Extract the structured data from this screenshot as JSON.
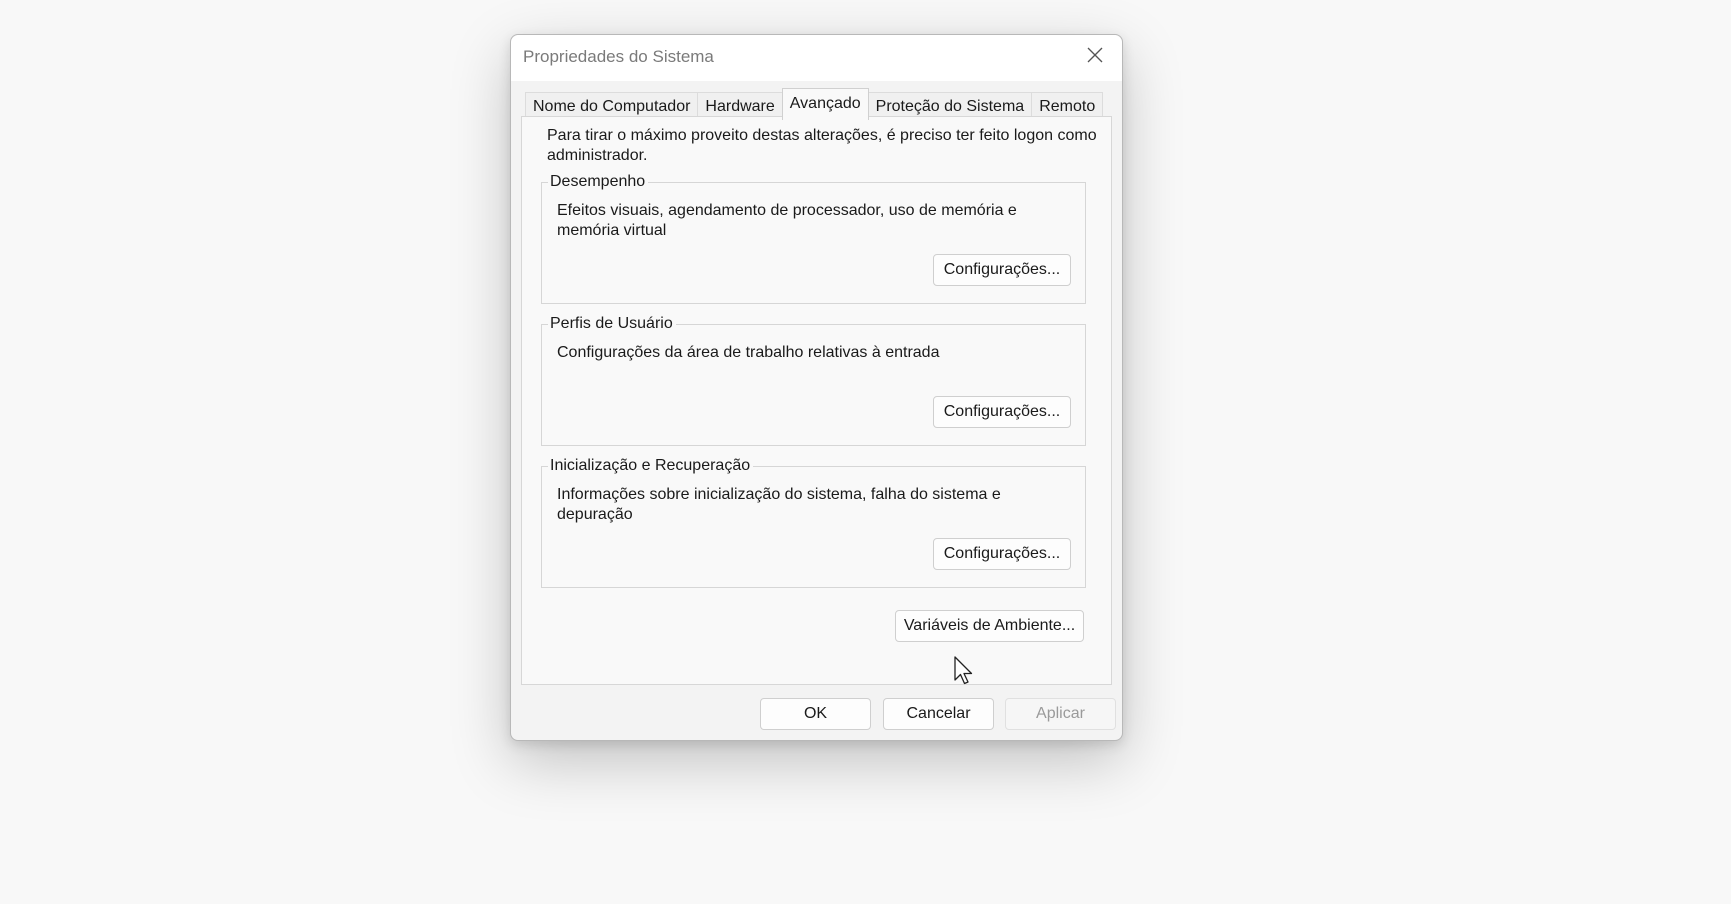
{
  "window": {
    "title": "Propriedades do Sistema"
  },
  "icons": {
    "close": "close-icon",
    "cursor": "mouse-pointer-icon"
  },
  "tabs": [
    {
      "label": "Nome do Computador",
      "active": false
    },
    {
      "label": "Hardware",
      "active": false
    },
    {
      "label": "Avançado",
      "active": true
    },
    {
      "label": "Proteção do Sistema",
      "active": false
    },
    {
      "label": "Remoto",
      "active": false
    }
  ],
  "advanced": {
    "intro": "Para tirar o máximo proveito destas alterações, é preciso ter feito logon como administrador.",
    "performance": {
      "title": "Desempenho",
      "description": "Efeitos visuais, agendamento de processador, uso de memória e memória virtual",
      "button": "Configurações..."
    },
    "user_profiles": {
      "title": "Perfis de Usuário",
      "description": "Configurações da área de trabalho relativas à entrada",
      "button": "Configurações..."
    },
    "startup_recovery": {
      "title": "Inicialização e Recuperação",
      "description": "Informações sobre inicialização do sistema, falha do sistema e depuração",
      "button": "Configurações..."
    },
    "env_button": "Variáveis de Ambiente..."
  },
  "footer": {
    "ok": "OK",
    "cancel": "Cancelar",
    "apply": "Aplicar",
    "apply_enabled": false
  }
}
